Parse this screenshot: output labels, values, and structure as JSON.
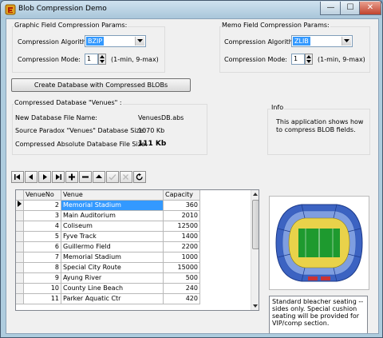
{
  "window": {
    "title": "Blob Compression Demo",
    "controls": {
      "minimize": "—",
      "maximize": "☐",
      "close": "✕"
    }
  },
  "graphic": {
    "group_label": "Graphic Field Compression Params:",
    "algorithm_label": "Compression Algorithm:",
    "algorithm_value": "BZIP",
    "mode_label": "Compression Mode:",
    "mode_value": "1",
    "mode_hint": "(1-min, 9-max)"
  },
  "memo_params": {
    "group_label": "Memo Field Compression Params:",
    "algorithm_label": "Compression Algorithm:",
    "algorithm_value": "ZLIB",
    "mode_label": "Compression Mode:",
    "mode_value": "1",
    "mode_hint": "(1-min, 9-max)"
  },
  "create_button": "Create Database with Compressed  BLOBs",
  "db_info": {
    "group_label": "Compressed Database \"Venues\" :",
    "file_label": "New Database File Name:",
    "file_value": "VenuesDB.abs",
    "src_label": "Source Paradox \"Venues\" Database Size:",
    "src_value": "1070 Kb",
    "abs_label": "Compressed Absolute Database File Size:",
    "abs_value": "111 Kb"
  },
  "info": {
    "group_label": "Info",
    "text": "This application shows how to compress BLOB fields."
  },
  "navigator": [
    "first-icon",
    "prior-icon",
    "next-icon",
    "last-icon",
    "insert-icon",
    "delete-icon",
    "edit-icon",
    "post-icon",
    "cancel-icon",
    "refresh-icon"
  ],
  "table": {
    "columns": [
      "VenueNo",
      "Venue",
      "Capacity"
    ],
    "rows": [
      [
        "2",
        "Memorial Stadium",
        "360"
      ],
      [
        "3",
        "Main Auditorium",
        "2010"
      ],
      [
        "4",
        "Coliseum",
        "12500"
      ],
      [
        "5",
        "Fyve Track",
        "1400"
      ],
      [
        "6",
        "Guillermo Field",
        "2200"
      ],
      [
        "7",
        "Memorial Stadium",
        "1000"
      ],
      [
        "8",
        "Special City Route",
        "15000"
      ],
      [
        "9",
        "Ayung River",
        "500"
      ],
      [
        "10",
        "County Line Beach",
        "240"
      ],
      [
        "11",
        "Parker Aquatic Ctr",
        "420"
      ]
    ]
  },
  "memo_text": "Standard bleacher seating -- sides only.  Special cushion seating will be provided for VIP/comp section.",
  "colors": {
    "selection": "#3399ff",
    "field": "#1e9a2f",
    "seats": "#2d55b5"
  }
}
